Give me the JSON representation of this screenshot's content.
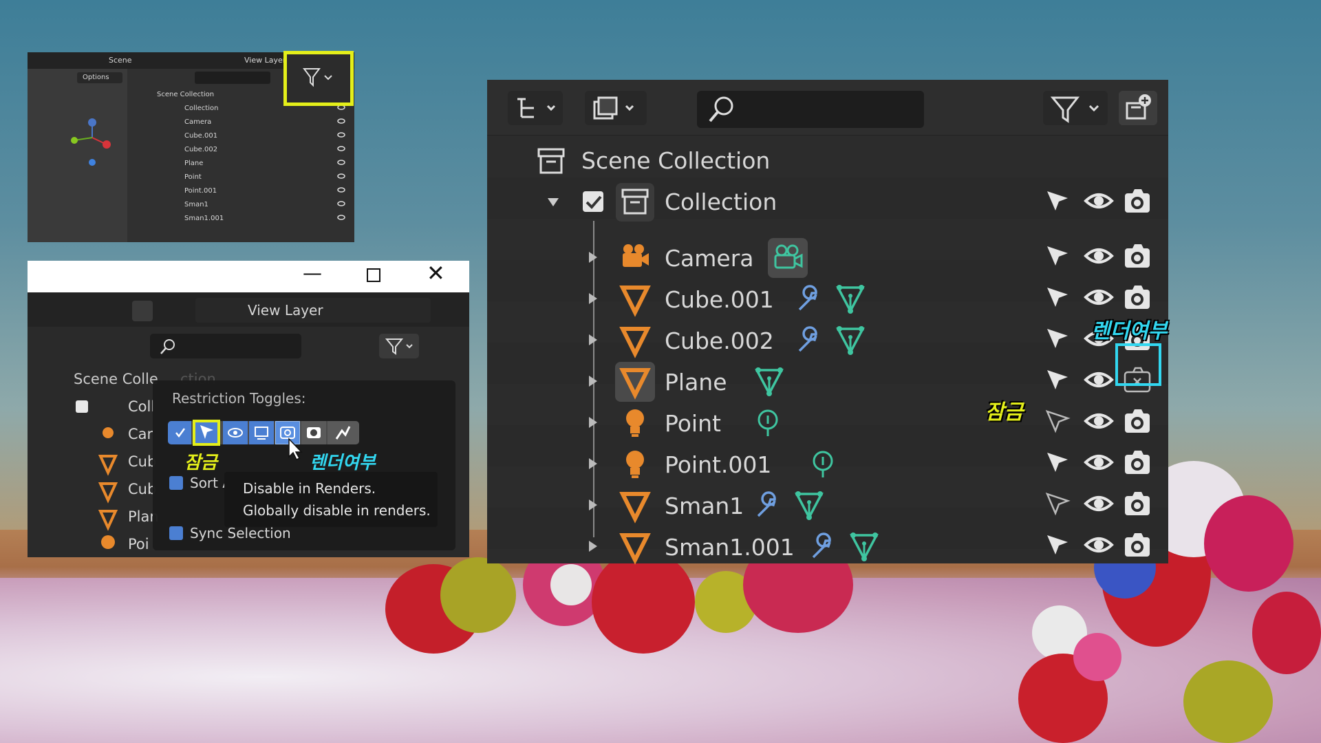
{
  "thumb": {
    "scene_label": "Scene",
    "view_layer_label": "View Layer",
    "options_label": "Options",
    "tree": [
      "Scene Collection",
      "Collection",
      "Camera",
      "Cube.001",
      "Cube.002",
      "Plane",
      "Point",
      "Point.001",
      "Sman1",
      "Sman1.001"
    ]
  },
  "popup": {
    "view_layer_label": "View Layer",
    "scene_collection": "Scene Colle",
    "scene_collection_tail": "ction",
    "tree": [
      "Coll",
      "Car",
      "Cub",
      "Cub",
      "Plan",
      "Poi"
    ],
    "restriction_title": "Restriction Toggles:",
    "lock_annotation": "잠금",
    "render_annotation": "렌더여부",
    "sort_label": "Sort A",
    "sync_label": "Sync Selection",
    "tooltip_title": "Disable in Renders.",
    "tooltip_desc": "Globally disable in renders."
  },
  "outliner": {
    "scene_collection": "Scene Collection",
    "collection": "Collection",
    "items": [
      {
        "name": "Camera",
        "type": "camera-icon",
        "data": "camera-data-icon",
        "mod": false,
        "select_disabled": false,
        "render_disabled": false
      },
      {
        "name": "Cube.001",
        "type": "mesh-icon",
        "data": "mesh-data-icon",
        "mod": true,
        "select_disabled": false,
        "render_disabled": false
      },
      {
        "name": "Cube.002",
        "type": "mesh-icon",
        "data": "mesh-data-icon",
        "mod": true,
        "select_disabled": false,
        "render_disabled": false
      },
      {
        "name": "Plane",
        "type": "mesh-icon",
        "data": "mesh-data-icon",
        "mod": false,
        "select_disabled": false,
        "render_disabled": true
      },
      {
        "name": "Point",
        "type": "light-icon",
        "data": "light-data-icon",
        "mod": false,
        "select_disabled": true,
        "render_disabled": false
      },
      {
        "name": "Point.001",
        "type": "light-icon",
        "data": "light-data-icon",
        "mod": false,
        "select_disabled": false,
        "render_disabled": false
      },
      {
        "name": "Sman1",
        "type": "mesh-icon",
        "data": "mesh-data-icon",
        "mod": true,
        "select_disabled": true,
        "render_disabled": false
      },
      {
        "name": "Sman1.001",
        "type": "mesh-icon",
        "data": "mesh-data-icon",
        "mod": true,
        "select_disabled": false,
        "render_disabled": false
      }
    ],
    "lock_annotation": "잠금",
    "render_annotation": "렌더여부"
  },
  "colors": {
    "highlight_yellow": "#e4ef1a",
    "annotation_cyan": "#32d7f0",
    "object_orange": "#e8892c",
    "data_green": "#3fc5a0",
    "modifier_blue": "#6f9fe0",
    "panel_bg": "#303030"
  }
}
